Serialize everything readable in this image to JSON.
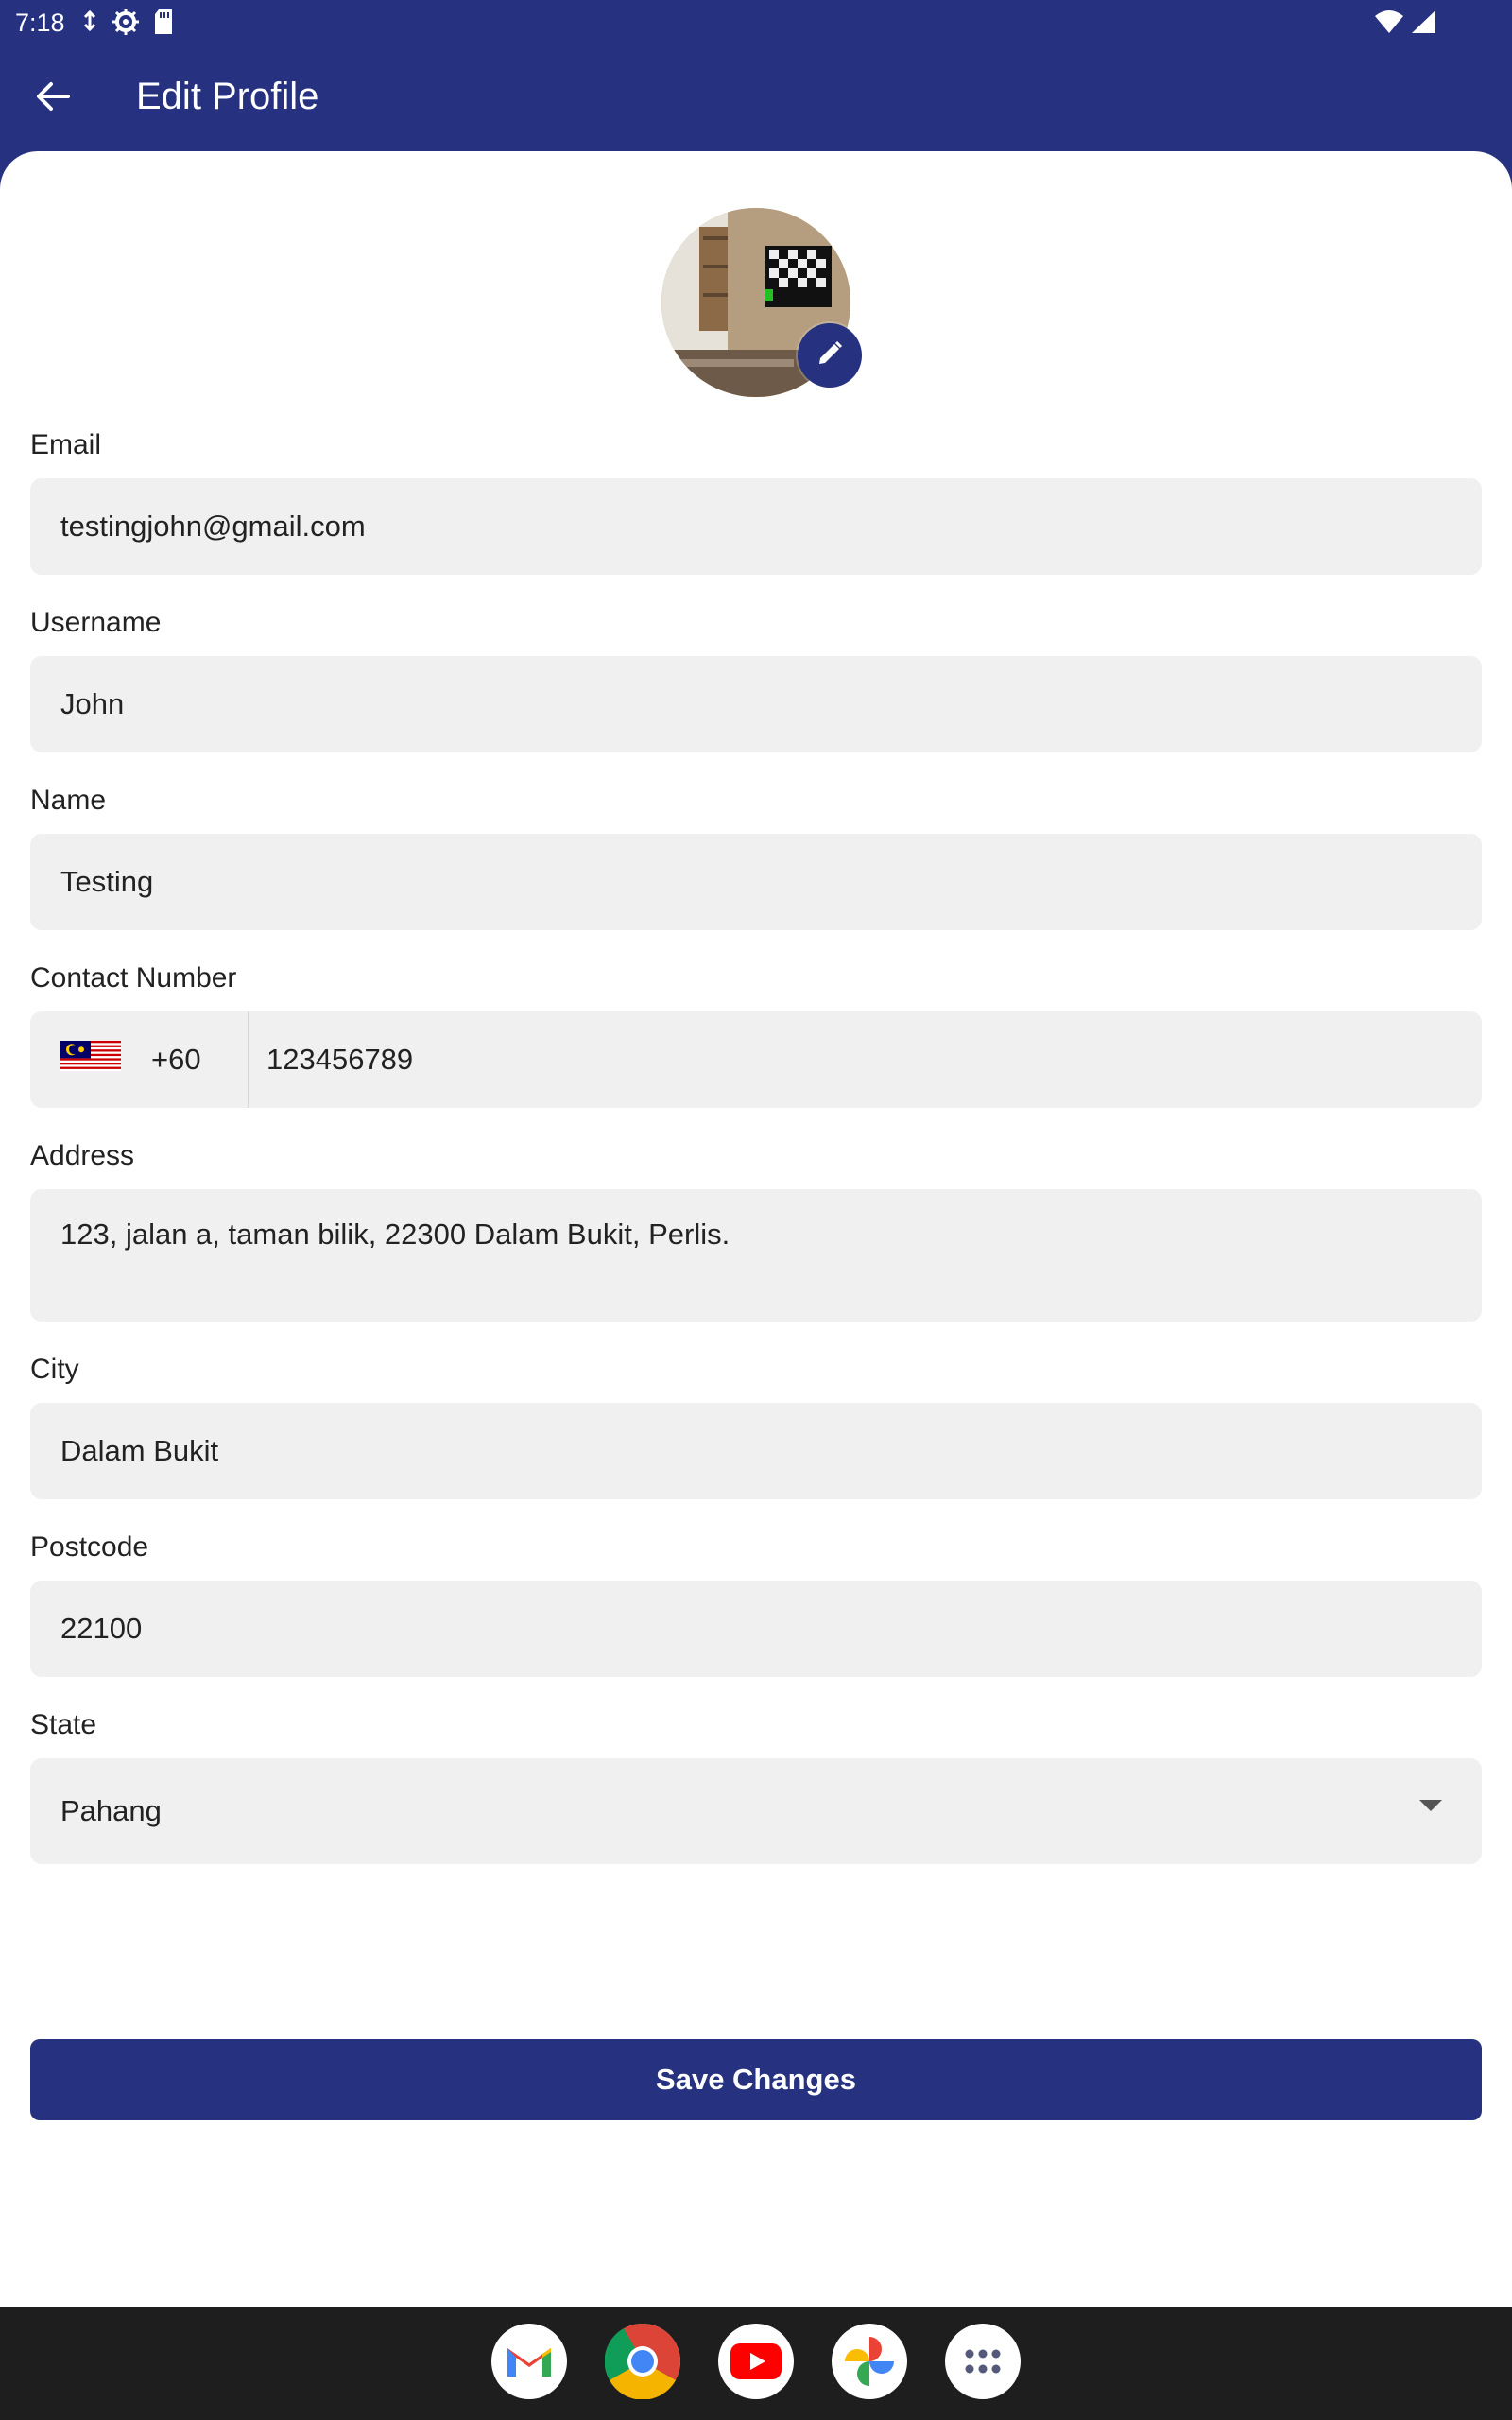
{
  "status_bar": {
    "time": "7:18"
  },
  "app_bar": {
    "title": "Edit Profile"
  },
  "form": {
    "email": {
      "label": "Email",
      "value": "testingjohn@gmail.com"
    },
    "username": {
      "label": "Username",
      "value": "John"
    },
    "name": {
      "label": "Name",
      "value": "Testing"
    },
    "contact": {
      "label": "Contact Number",
      "country_code": "+60",
      "value": "123456789"
    },
    "address": {
      "label": "Address",
      "value": "123, jalan a, taman bilik, 22300 Dalam Bukit, Perlis."
    },
    "city": {
      "label": "City",
      "value": "Dalam Bukit"
    },
    "postcode": {
      "label": "Postcode",
      "value": "22100"
    },
    "state": {
      "label": "State",
      "value": "Pahang"
    }
  },
  "actions": {
    "save_label": "Save Changes"
  },
  "dock": {
    "apps": [
      "gmail-icon",
      "chrome-icon",
      "youtube-icon",
      "photos-icon",
      "app-drawer-icon"
    ]
  },
  "colors": {
    "primary": "#26317f",
    "field_bg": "#f0f0f0",
    "bottom_bar": "#1e1e1e"
  }
}
